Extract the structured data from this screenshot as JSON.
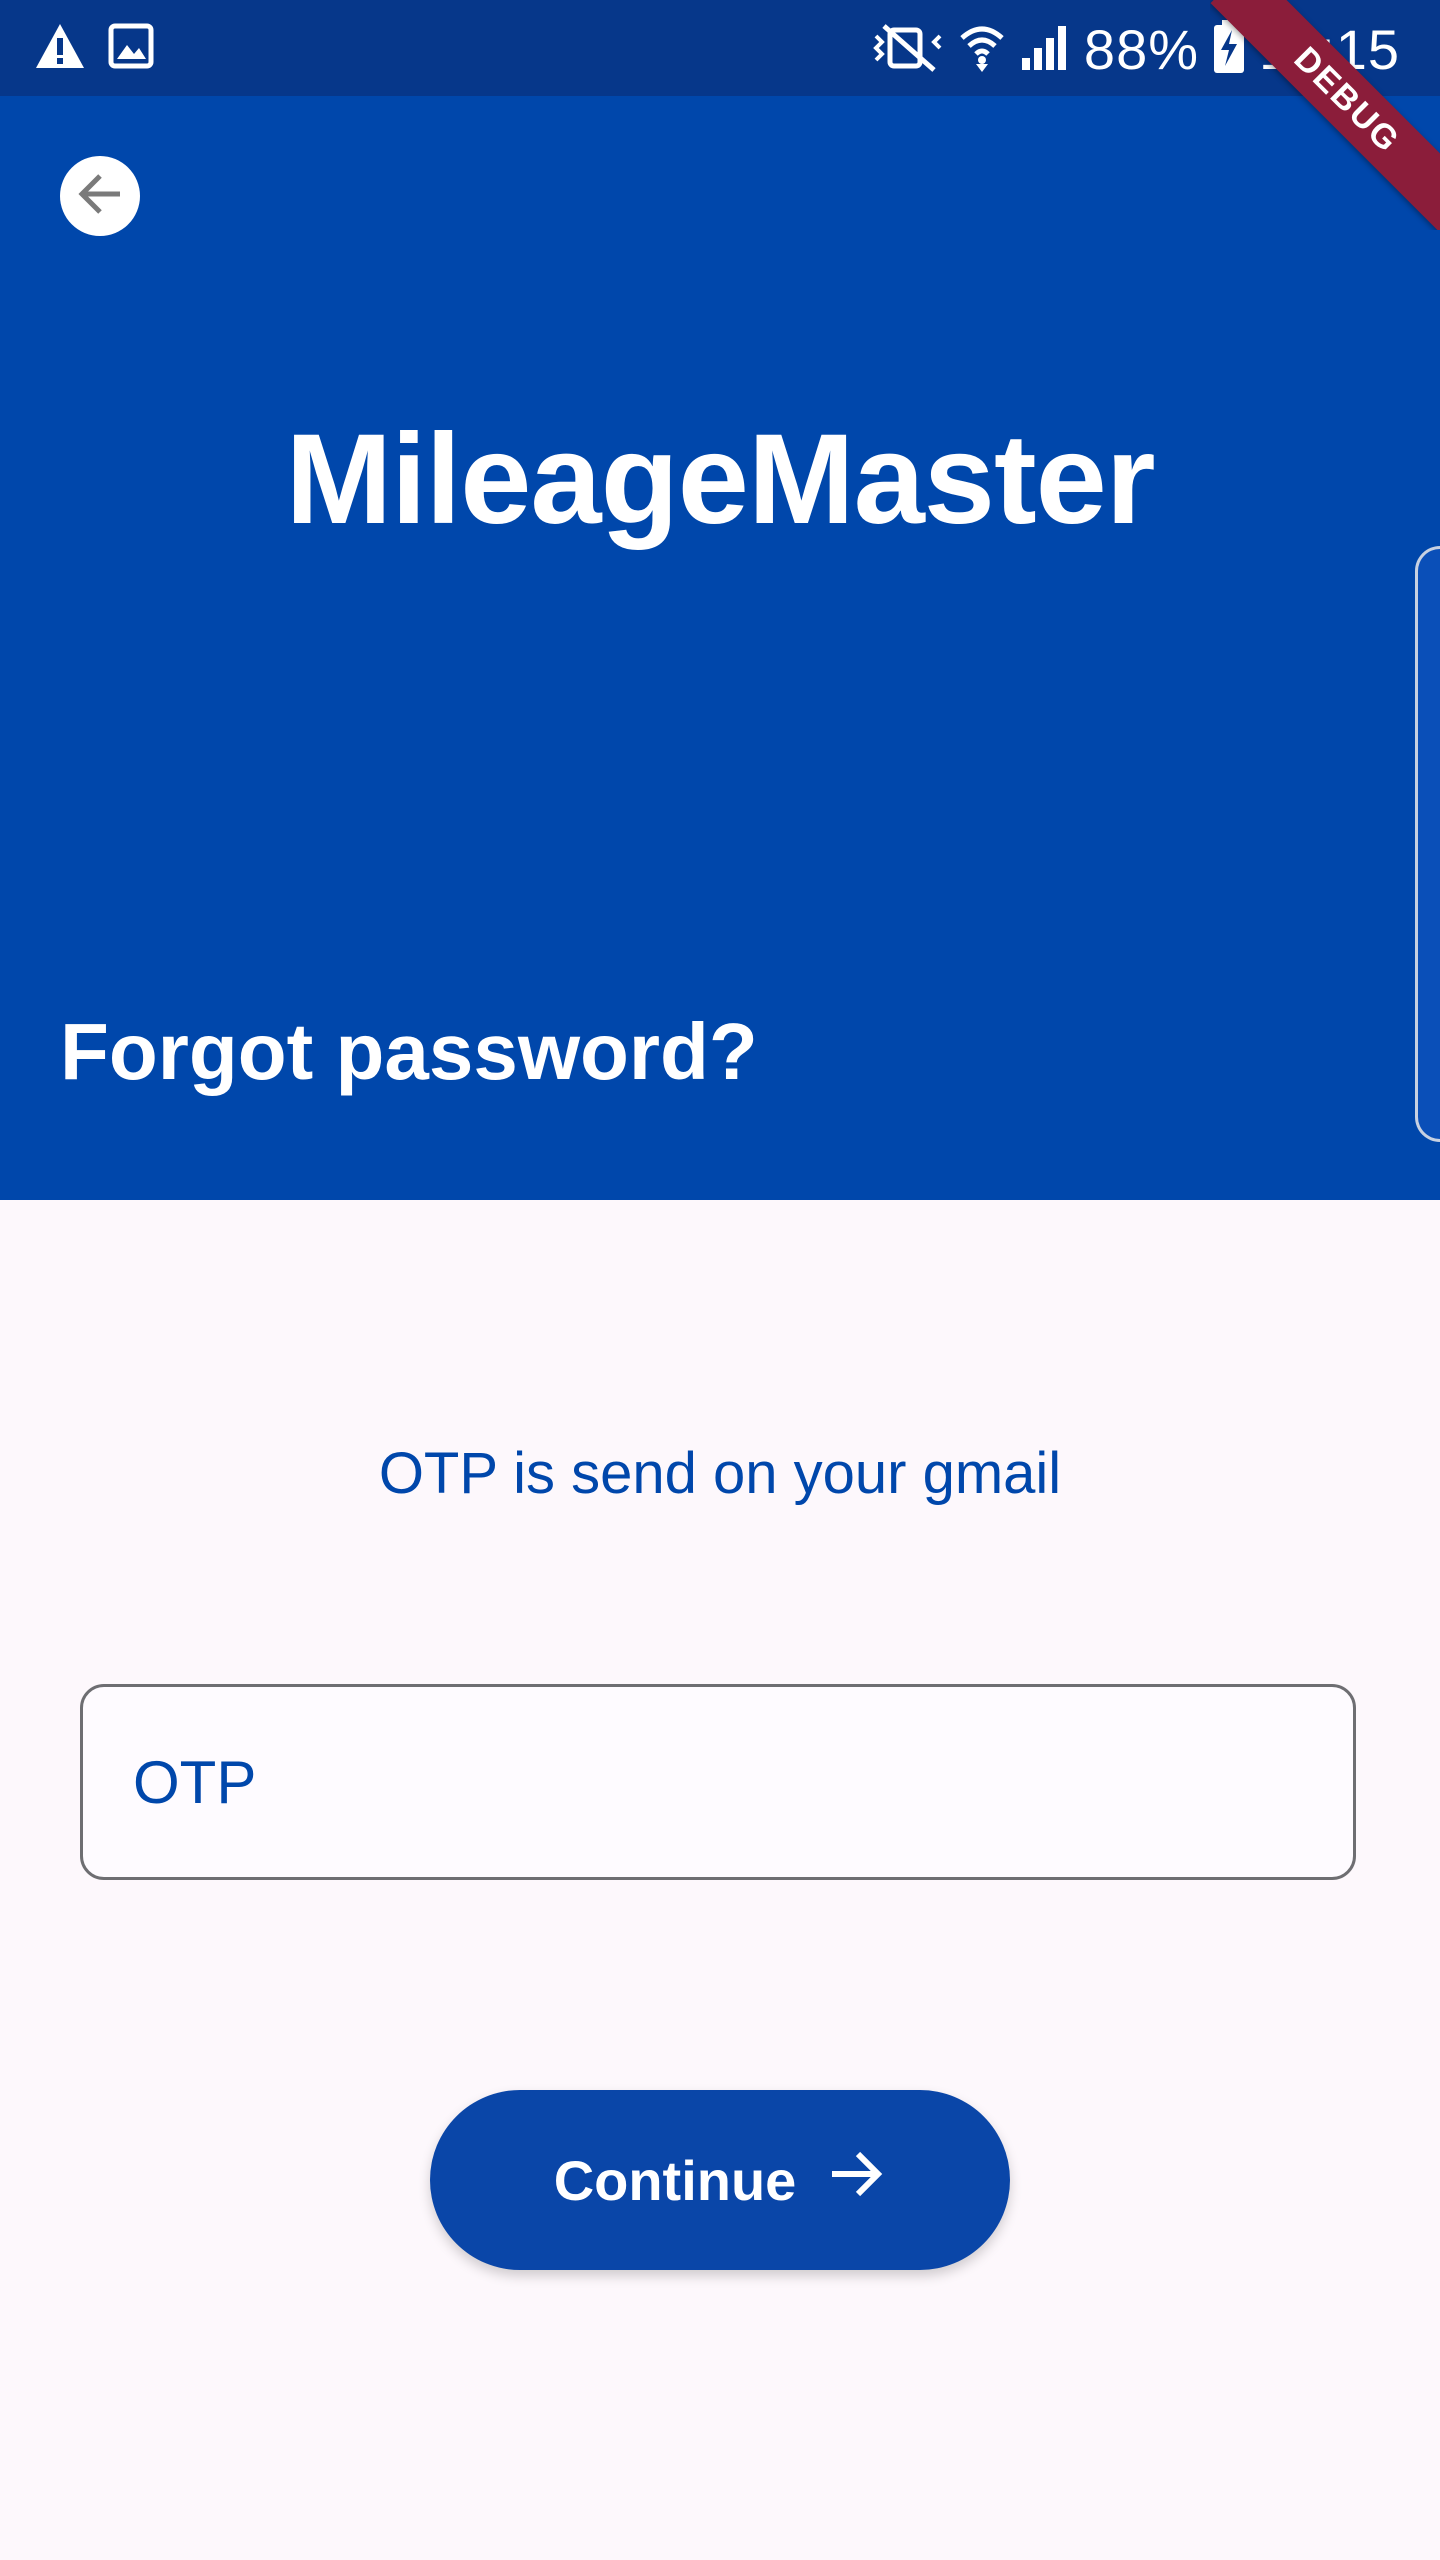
{
  "statusbar": {
    "battery": "88%",
    "time": "11:15",
    "left_icons": [
      "warning-icon",
      "image-icon"
    ],
    "right_icons": [
      "vibrate-off-icon",
      "wifi-icon",
      "signal-icon",
      "battery-charging-icon"
    ]
  },
  "debug_banner": "DEBUG",
  "header": {
    "app_title": "MileageMaster",
    "screen_title": "Forgot password?"
  },
  "main": {
    "otp_message": "OTP is send on your gmail",
    "otp_input": {
      "placeholder": "OTP",
      "value": ""
    },
    "continue_label": "Continue"
  },
  "colors": {
    "status_bar": "#06378a",
    "header": "#0047ab",
    "accent_text": "#0047ab",
    "button": "#0a46a8",
    "background": "#fdf8fc"
  }
}
